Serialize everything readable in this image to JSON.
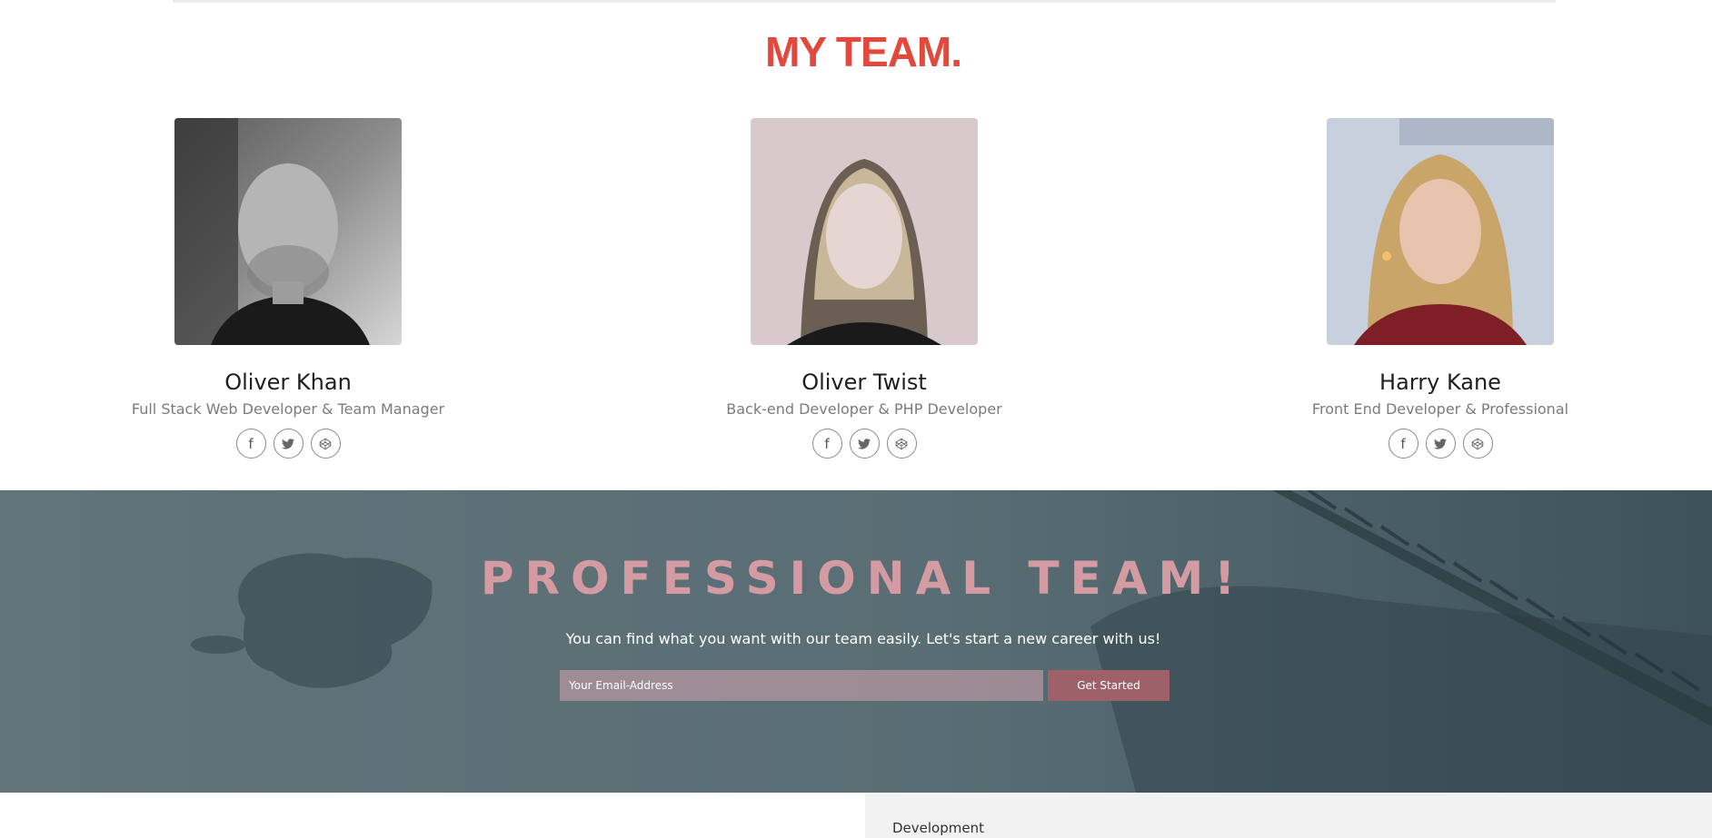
{
  "team_section": {
    "title": "MY TEAM."
  },
  "members": [
    {
      "name": "Oliver Khan",
      "role": "Full Stack Web Developer & Team Manager",
      "socials": [
        {
          "icon": "facebook-icon",
          "glyph": "f"
        },
        {
          "icon": "twitter-icon",
          "glyph": "🐦"
        },
        {
          "icon": "codepen-icon",
          "glyph": "⬡"
        }
      ]
    },
    {
      "name": "Oliver Twist",
      "role": "Back-end Developer & PHP Developer",
      "socials": [
        {
          "icon": "facebook-icon",
          "glyph": "f"
        },
        {
          "icon": "twitter-icon",
          "glyph": "🐦"
        },
        {
          "icon": "codepen-icon",
          "glyph": "⬡"
        }
      ]
    },
    {
      "name": "Harry Kane",
      "role": "Front End Developer & Professional",
      "socials": [
        {
          "icon": "facebook-icon",
          "glyph": "f"
        },
        {
          "icon": "twitter-icon",
          "glyph": "🐦"
        },
        {
          "icon": "codepen-icon",
          "glyph": "⬡"
        }
      ]
    }
  ],
  "banner": {
    "title": "PROFESSIONAL TEAM!",
    "subtitle": "You can find what you want with our team easily. Let's start a new career with us!",
    "email_placeholder": "Your Email-Address",
    "button_label": "Get Started"
  },
  "footer_panel": {
    "label": "Development"
  },
  "colors": {
    "title_red": "#e2483b",
    "banner_title_pink": "#d49ba3",
    "button_bg": "#9f6168",
    "banner_overlay": "#4f646c"
  }
}
